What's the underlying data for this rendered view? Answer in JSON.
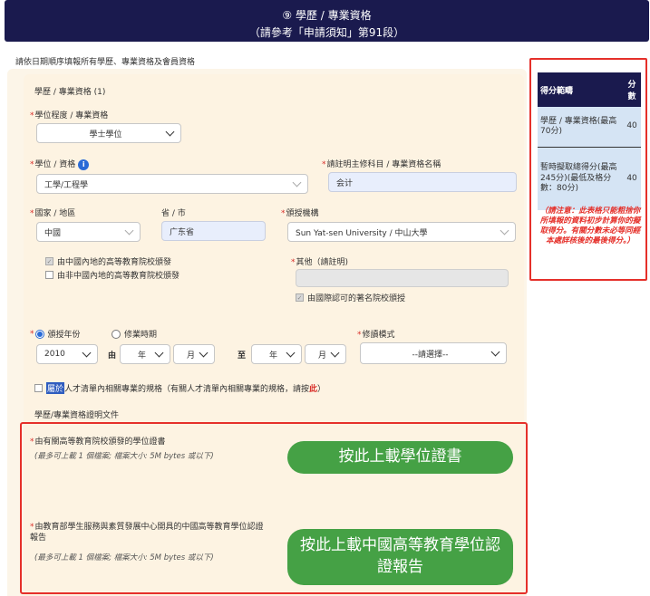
{
  "header": {
    "line1": "⑨ 學歷 / 專業資格",
    "line2": "（請參考「申請須知」第91段）"
  },
  "instruction": "請依日期順序填報所有學歷、專業資格及會員資格",
  "section": {
    "title": "學歷 / 專業資格 (1)",
    "degree_level": {
      "label": "學位程度 / 專業資格",
      "value": "學士學位"
    },
    "degree": {
      "label": "學位 / 資格",
      "value": "工學/工程學"
    },
    "major": {
      "label": "請註明主修科目 / 專業資格名稱",
      "value": "会计"
    },
    "country": {
      "label": "國家 / 地區",
      "value": "中國"
    },
    "province": {
      "label": "省 / 市",
      "value": "广东省"
    },
    "institution": {
      "label": "頒授機構",
      "value": "Sun Yat-sen University / 中山大學"
    },
    "chk_mainland_recognised": "由中國內地的高等教育院校頒發",
    "chk_mainland_not": "由非中國內地的高等教育院校頒發",
    "other": {
      "label": "其他（請註明)"
    },
    "chk_intl_recognised": "由國際認可的著名院校頒授",
    "radio_award_year": "頒授年份",
    "radio_study_period": "修業時期",
    "award_year_value": "2010",
    "from_label": "由",
    "to_label": "至",
    "from_year_ph": "年",
    "from_month_ph": "月",
    "to_year_ph": "年",
    "to_month_ph": "月",
    "study_mode": {
      "label": "修讀模式",
      "value": "--請選擇--"
    },
    "talent_hl": "屬於",
    "talent_text": "人才清單內相關專業的規格（有關人才清單內相關專業的規格，請按",
    "talent_link": "此",
    "talent_end": "）",
    "docs_title": "學歷/專業資格證明文件"
  },
  "uploads": [
    {
      "label": "由有關高等教育院校頒發的學位證書",
      "note": "(最多可上載 1 個檔案; 檔案大小: 5M bytes 或以下)",
      "button": "按此上載學位證書"
    },
    {
      "label": "由教育部學生服務與素質發展中心開具的中國高等教育學位認證報告",
      "note": "(最多可上載 1 個檔案; 檔案大小: 5M bytes 或以下)",
      "button": "按此上載中國高等教育學位認證報告"
    }
  ],
  "score": {
    "head_range": "得分範疇",
    "head_score": "分數",
    "row1_label": "學歷 / 專業資格(最高70分)",
    "row1_value": "40",
    "row2_label": "暫時擬取總得分(最高245分)(最低及格分數：80分)",
    "row2_value": "40",
    "note": "（請注意：此表格只能粗捨你所填報的資料初步計算你的擬取得分。有關分數未必等同經本處詳核後的最後得分。）"
  },
  "colors": {
    "header_bg": "#1a1a4e",
    "accent_red": "#e5302a",
    "button_green": "#45a145"
  }
}
